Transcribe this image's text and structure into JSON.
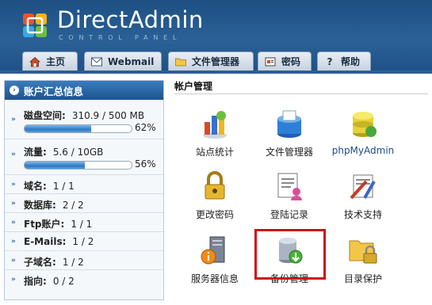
{
  "header": {
    "title": "DirectAdmin",
    "subtitle": "CONTROL PANEL",
    "tabs": [
      {
        "label": "主页",
        "icon": "home-icon"
      },
      {
        "label": "Webmail",
        "icon": "mail-icon"
      },
      {
        "label": "文件管理器",
        "icon": "folder-icon"
      },
      {
        "label": "密码",
        "icon": "password-icon"
      },
      {
        "label": "帮助",
        "icon": "help-icon"
      }
    ]
  },
  "sidebar": {
    "title": "账户汇总信息",
    "disk": {
      "label": "磁盘空间:",
      "value": "310.9 / 500 MB",
      "percent_text": "62%",
      "fraction": 0.62
    },
    "traffic": {
      "label": "流量:",
      "value": "5.6 / 10GB",
      "percent_text": "56%",
      "fraction": 0.56
    },
    "stats": [
      {
        "label": "域名:",
        "value": "1 / 1"
      },
      {
        "label": "数据库:",
        "value": "2 / 2"
      },
      {
        "label": "Ftp账户:",
        "value": "1 / 1"
      },
      {
        "label": "E-Mails:",
        "value": "1 / 2"
      },
      {
        "label": "子域名:",
        "value": "1 / 2"
      },
      {
        "label": "指向:",
        "value": "0 / 2"
      }
    ]
  },
  "main": {
    "section_title": "帐户管理",
    "apps": [
      {
        "label": "站点统计",
        "icon": "site-stats-icon"
      },
      {
        "label": "文件管理器",
        "icon": "file-manager-icon"
      },
      {
        "label": "phpMyAdmin",
        "icon": "phpmyadmin-icon"
      },
      {
        "label": "更改密码",
        "icon": "change-password-icon"
      },
      {
        "label": "登陆记录",
        "icon": "login-log-icon"
      },
      {
        "label": "技术支持",
        "icon": "support-icon"
      },
      {
        "label": "服务器信息",
        "icon": "server-info-icon"
      },
      {
        "label": "备份管理",
        "icon": "backup-icon"
      },
      {
        "label": "目录保护",
        "icon": "directory-protect-icon"
      }
    ]
  },
  "colors": {
    "header_bg": "#2a6197",
    "highlight": "#cc1111",
    "bar_fill": "#2c78c4"
  }
}
